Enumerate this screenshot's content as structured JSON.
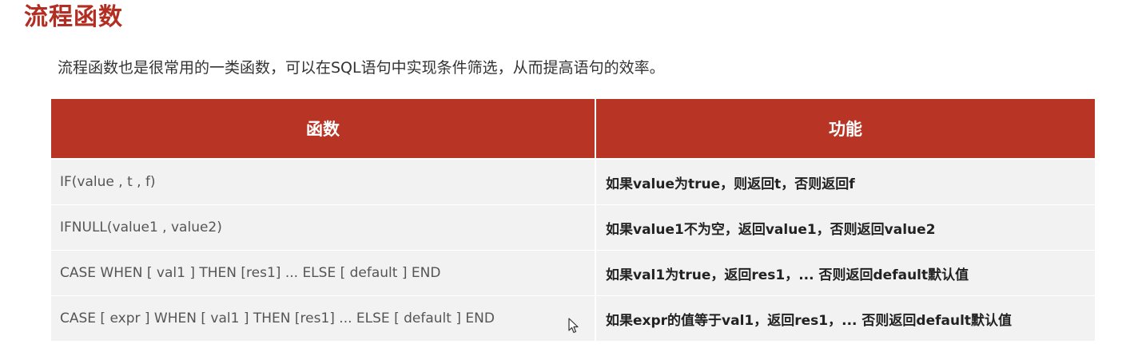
{
  "title": "流程函数",
  "intro": "流程函数也是很常用的一类函数，可以在SQL语句中实现条件筛选，从而提高语句的效率。",
  "table": {
    "headers": [
      "函数",
      "功能"
    ],
    "rows": [
      {
        "fn": "IF(value , t , f)",
        "desc": "如果value为true，则返回t，否则返回f"
      },
      {
        "fn": "IFNULL(value1 , value2)",
        "desc": "如果value1不为空，返回value1，否则返回value2"
      },
      {
        "fn": "CASE  WHEN  [ val1 ]  THEN  [res1]  ... ELSE [ default ]  END",
        "desc": "如果val1为true，返回res1，... 否则返回default默认值"
      },
      {
        "fn": "CASE [ expr ]  WHEN  [ val1 ]  THEN  [res1]  ... ELSE [ default ]  END",
        "desc": "如果expr的值等于val1，返回res1，... 否则返回default默认值"
      }
    ]
  },
  "colors": {
    "accent": "#b83525",
    "title": "#b22e22",
    "row_bg": "#f2f2f2"
  },
  "icons": {
    "cursor": "mouse-pointer-icon"
  }
}
